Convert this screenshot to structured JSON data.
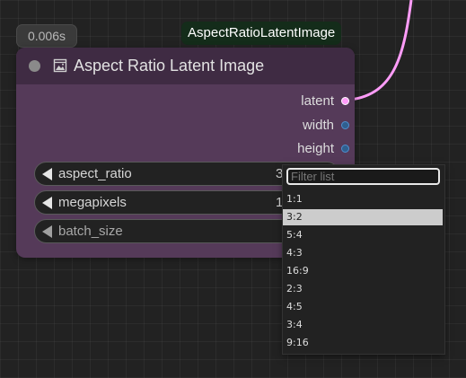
{
  "timing": "0.006s",
  "node_type": "AspectRatioLatentImage",
  "node": {
    "title": "Aspect Ratio Latent Image",
    "icon": "image-icon",
    "outputs": [
      {
        "label": "latent",
        "color": "#ff9cf9"
      },
      {
        "label": "width",
        "color": "#2f5f8f"
      },
      {
        "label": "height",
        "color": "#2f5f8f"
      }
    ],
    "widgets": [
      {
        "label": "aspect_ratio",
        "value": "3"
      },
      {
        "label": "megapixels",
        "value": "1"
      },
      {
        "label": "batch_size",
        "value": ""
      }
    ]
  },
  "dropdown": {
    "filter_placeholder": "Filter list",
    "filter_value": "",
    "options": [
      "1:1",
      "3:2",
      "5:4",
      "4:3",
      "16:9",
      "2:3",
      "4:5",
      "3:4",
      "9:16"
    ],
    "selected": "3:2"
  },
  "colors": {
    "canvas": "#222222",
    "node_body": "#553a59",
    "node_header": "#3f2b43",
    "latent_wire": "#ff9cf9",
    "type_badge": "#142c1a"
  }
}
